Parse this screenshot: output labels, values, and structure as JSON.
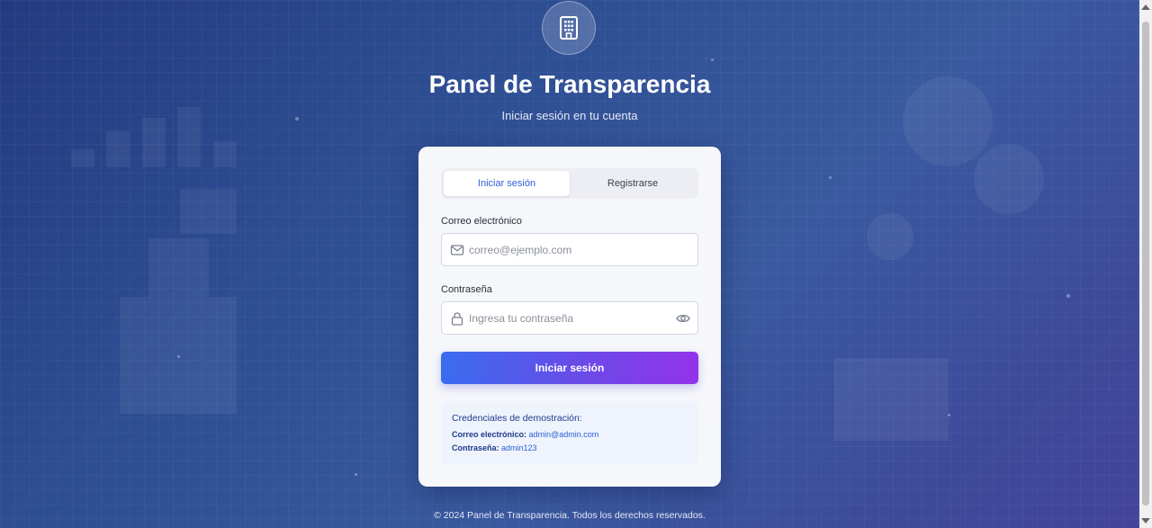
{
  "app": {
    "title": "Panel de Transparencia",
    "subtitle": "Iniciar sesión en tu cuenta",
    "logo_icon": "building-icon"
  },
  "tabs": {
    "login_label": "Iniciar sesión",
    "register_label": "Registrarse",
    "active": "login"
  },
  "form": {
    "email_label": "Correo electrónico",
    "email_placeholder": "correo@ejemplo.com",
    "email_icon": "mail-icon",
    "password_label": "Contraseña",
    "password_placeholder": "Ingresa tu contraseña",
    "password_icon": "lock-icon",
    "toggle_icon": "eye-icon",
    "submit_label": "Iniciar sesión"
  },
  "demo": {
    "title": "Credenciales de demostración:",
    "email_key": "Correo electrónico:",
    "email_value": "admin@admin.com",
    "password_key": "Contraseña:",
    "password_value": "admin123"
  },
  "footer": {
    "text": "© 2024 Panel de Transparencia. Todos los derechos reservados."
  },
  "colors": {
    "accent": "#2c5fd6",
    "gradient_start": "#3a6df0",
    "gradient_end": "#9333ea",
    "background": "#2f4f94"
  }
}
